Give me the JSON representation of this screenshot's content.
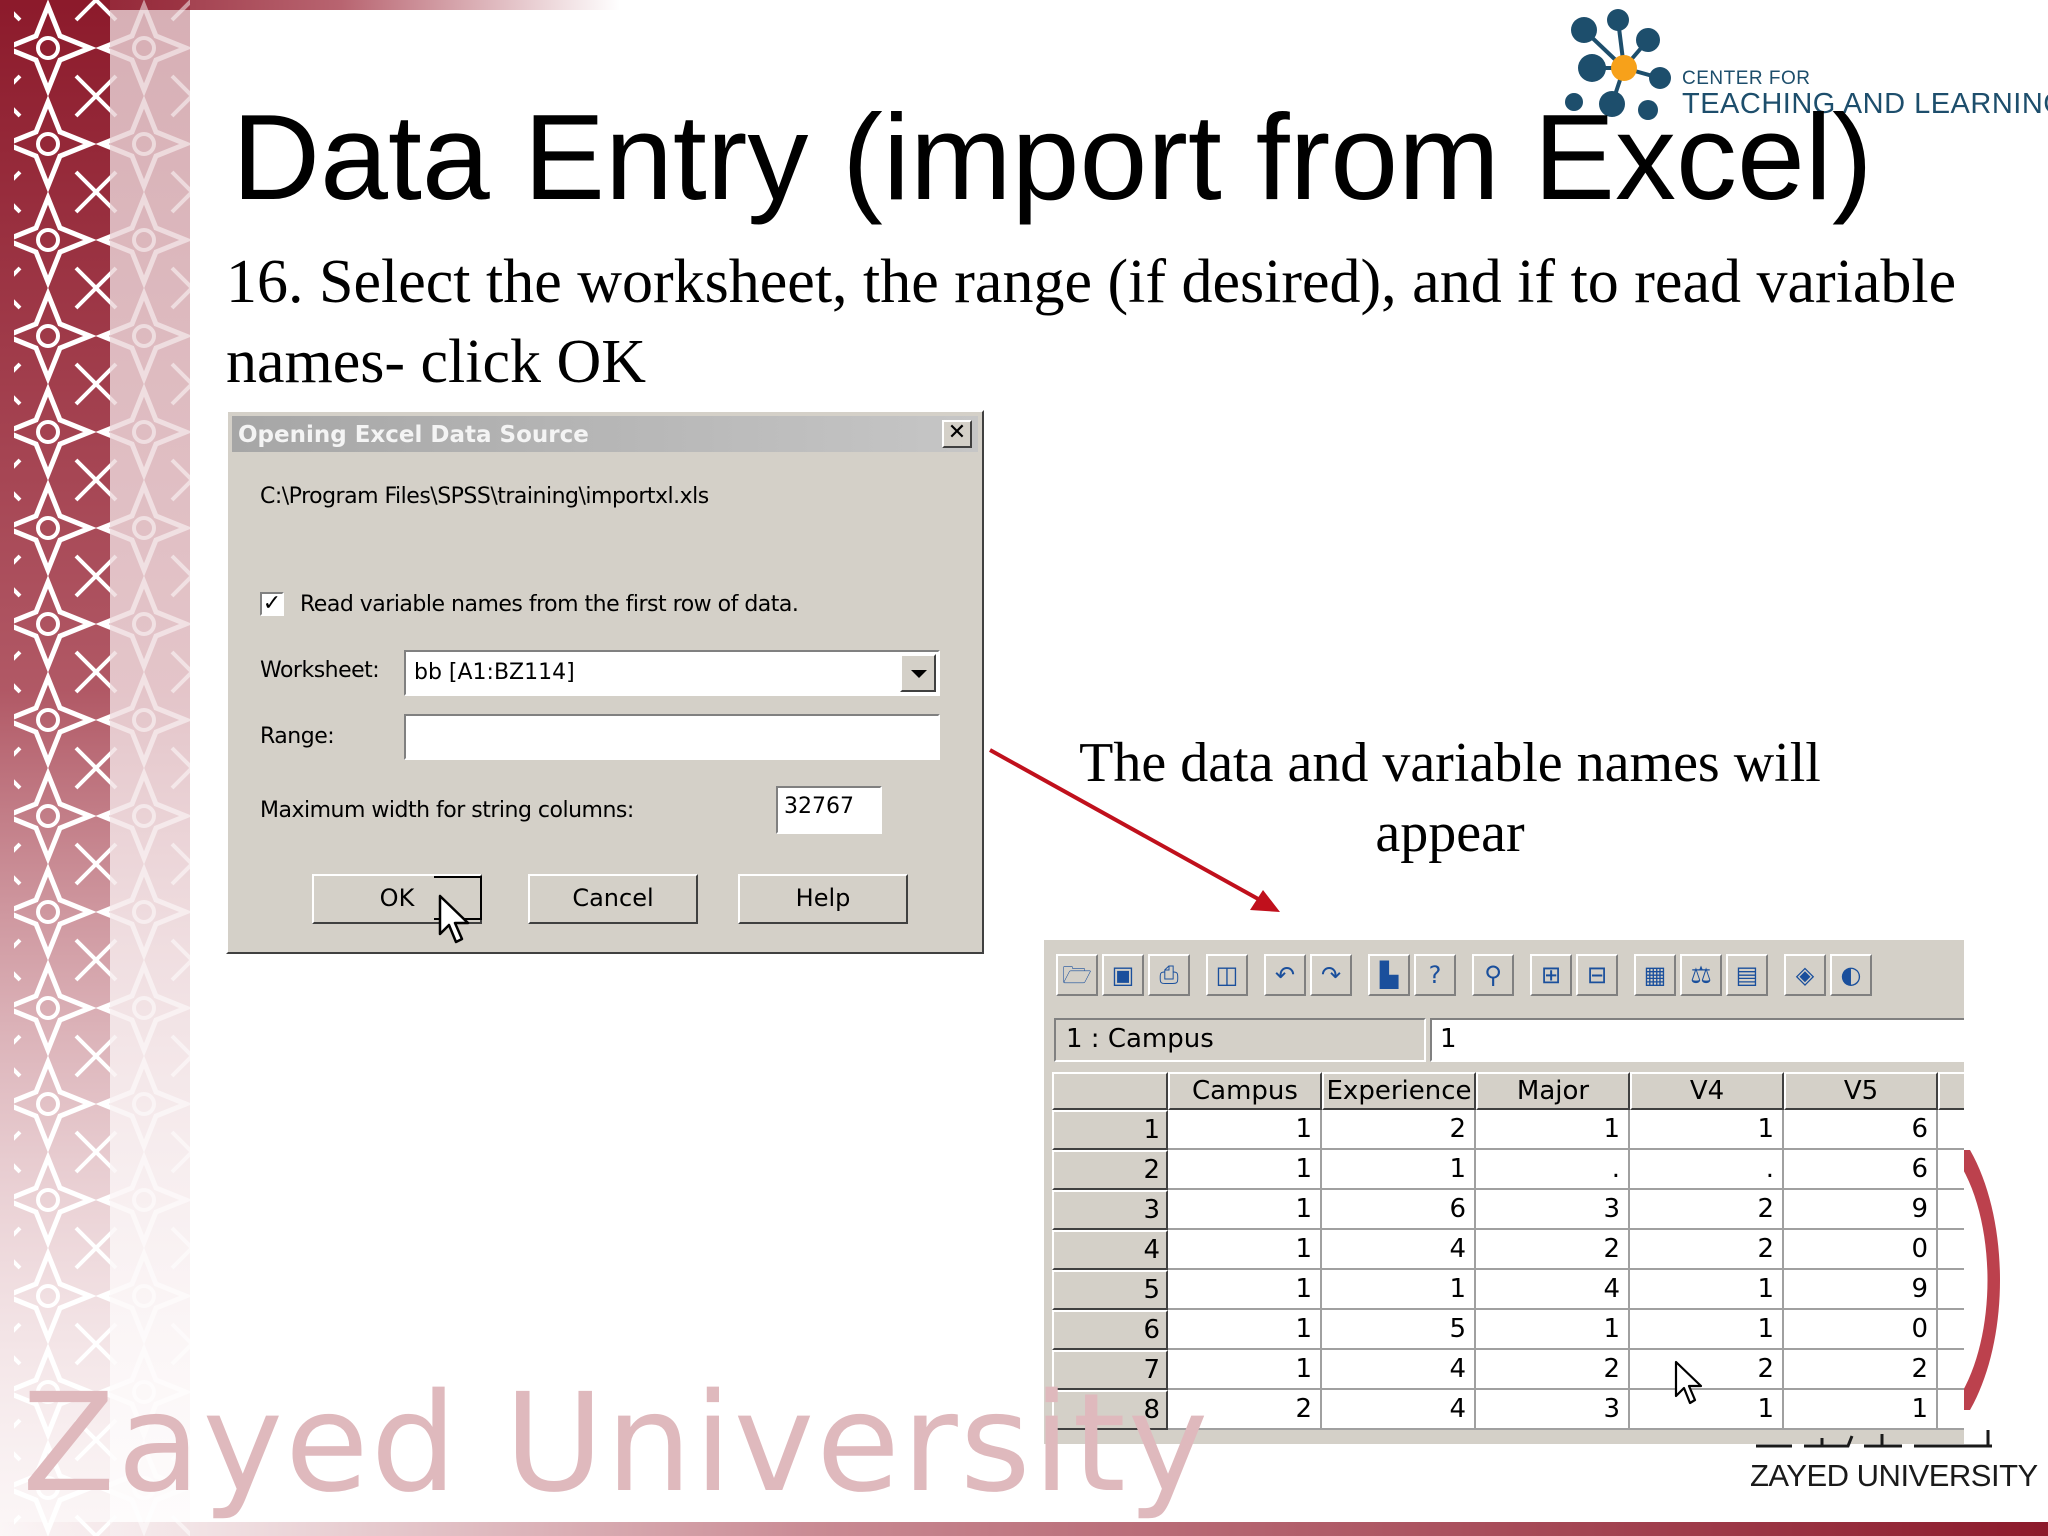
{
  "slide": {
    "title": "Data Entry (import from Excel)",
    "subtitle": "16. Select the worksheet, the range (if desired), and if to read variable names- click OK",
    "annotation": "The data and variable names will appear",
    "footer_wordmark": "Zayed University",
    "footer_logo_text": "ZAYED UNIVERSITY",
    "logo": {
      "line1": "CENTER FOR",
      "line2": "TEACHING AND LEARNING"
    },
    "colors": {
      "brand_maroon": "#8c1a2b",
      "logo_blue": "#1d4e6c",
      "logo_orange": "#f7a11a",
      "arrow_red": "#c0101c",
      "dialog_face": "#d4d0c8"
    }
  },
  "dialog": {
    "title": "Opening Excel Data Source",
    "close_glyph": "✕",
    "file_path": "C:\\Program Files\\SPSS\\training\\importxl.xls",
    "read_names_checked": true,
    "checkbox_glyph": "✓",
    "read_names_label": "Read variable names from the first row of data.",
    "worksheet_label": "Worksheet:",
    "worksheet_value": "bb  [A1:BZ114]",
    "range_label": "Range:",
    "range_value": "",
    "max_width_label": "Maximum width for string columns:",
    "max_width_value": "32767",
    "buttons": {
      "ok": "OK",
      "cancel": "Cancel",
      "help": "Help"
    }
  },
  "editor": {
    "toolbar_icons": [
      "open-folder-icon",
      "save-icon",
      "print-icon",
      "dialog-recall-icon",
      "undo-icon",
      "redo-icon",
      "goto-chart-icon",
      "variables-icon",
      "find-icon",
      "insert-cases-icon",
      "insert-variable-icon",
      "split-file-icon",
      "weight-cases-icon",
      "select-cases-icon",
      "value-labels-icon",
      "use-sets-icon"
    ],
    "toolbar_glyphs": [
      "🗁",
      "▣",
      "⎙",
      "◫",
      "↶",
      "↷",
      "▙",
      "?",
      "⚲",
      "⊞",
      "⊟",
      "▦",
      "⚖",
      "▤",
      "◈",
      "◐"
    ],
    "cell_ref": "1 : Campus",
    "cell_value": "1",
    "columns": [
      "Campus",
      "Experience",
      "Major",
      "V4",
      "V5"
    ],
    "rows": [
      {
        "id": "1",
        "cells": [
          "1",
          "2",
          "1",
          "1",
          "6"
        ]
      },
      {
        "id": "2",
        "cells": [
          "1",
          "1",
          ".",
          ".",
          "6"
        ]
      },
      {
        "id": "3",
        "cells": [
          "1",
          "6",
          "3",
          "2",
          "9"
        ]
      },
      {
        "id": "4",
        "cells": [
          "1",
          "4",
          "2",
          "2",
          "0"
        ]
      },
      {
        "id": "5",
        "cells": [
          "1",
          "1",
          "4",
          "1",
          "9"
        ]
      },
      {
        "id": "6",
        "cells": [
          "1",
          "5",
          "1",
          "1",
          "0"
        ]
      },
      {
        "id": "7",
        "cells": [
          "1",
          "4",
          "2",
          "2",
          "2"
        ]
      },
      {
        "id": "8",
        "cells": [
          "2",
          "4",
          "3",
          "1",
          "1"
        ]
      }
    ]
  }
}
